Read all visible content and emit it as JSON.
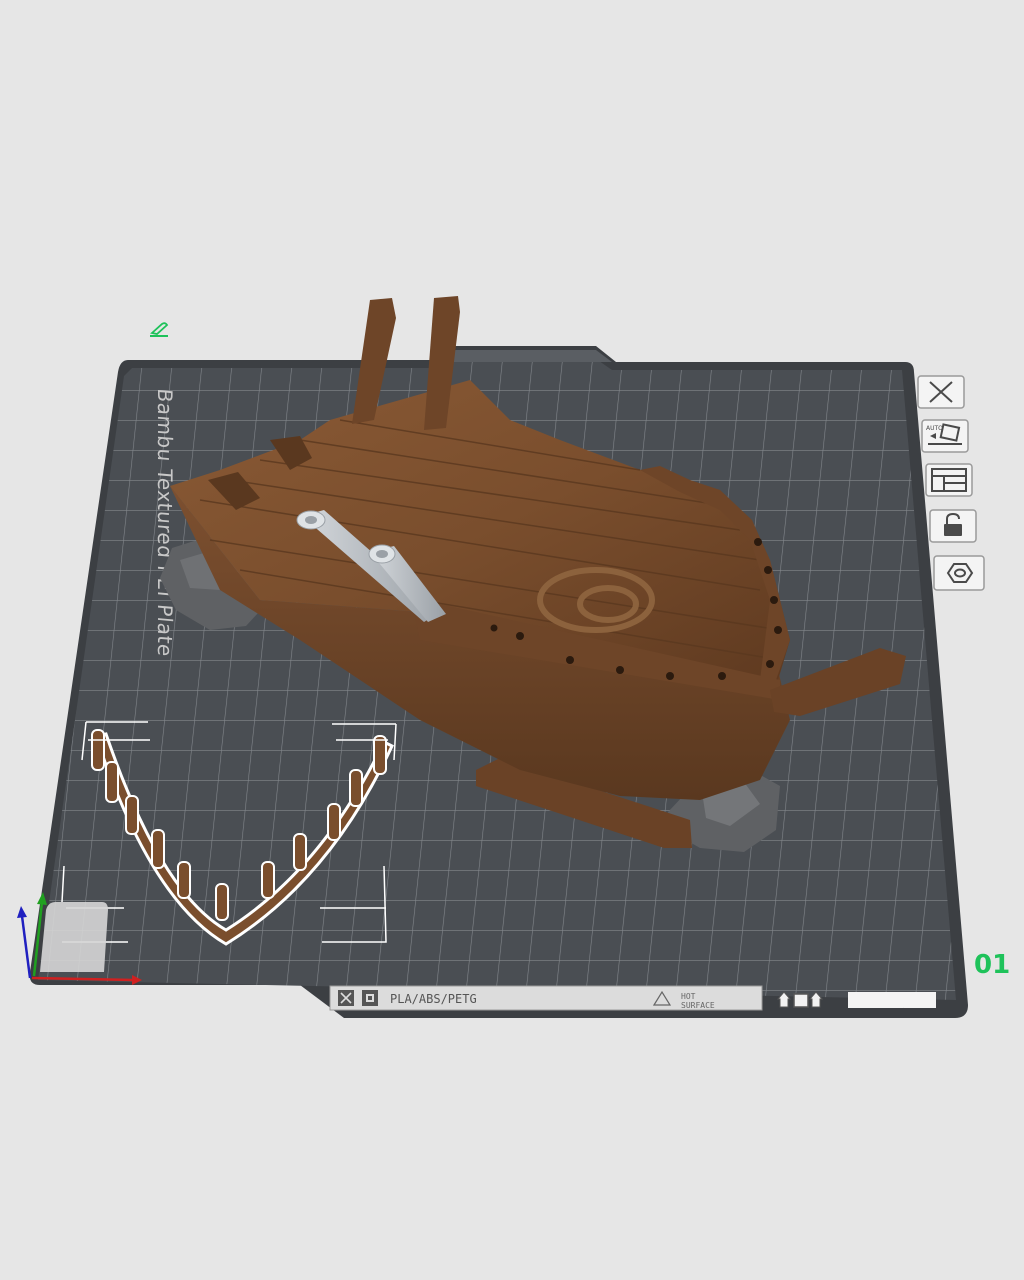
{
  "plate": {
    "label": "Bambu Textured PEI Plate",
    "number": "01",
    "color_plate": "#4a4e53",
    "color_grid": "#8a8e93",
    "color_border": "#3c3f43",
    "color_number": "#1ec25a"
  },
  "status_strip": {
    "filament_types": "PLA/ABS/PETG",
    "hot_surface_line1": "HOT",
    "hot_surface_line2": "SURFACE"
  },
  "toolbar": {
    "buttons": [
      {
        "name": "close-plate-button",
        "icon": "close-icon"
      },
      {
        "name": "auto-orient-button",
        "icon": "auto-orient-icon",
        "text": "AUTO"
      },
      {
        "name": "arrange-button",
        "icon": "arrange-icon"
      },
      {
        "name": "lock-plate-button",
        "icon": "lock-icon"
      },
      {
        "name": "plate-settings-button",
        "icon": "hexagon-settings-icon"
      }
    ]
  },
  "models": [
    {
      "name": "shipwreck-hull",
      "color": "#7a4e2d"
    },
    {
      "name": "cannon-pair",
      "color": "#b9bec3"
    },
    {
      "name": "rocks",
      "color": "#5f6164"
    },
    {
      "name": "rib-rail-part",
      "color": "#7a4e2d"
    }
  ],
  "axes": {
    "x_color": "#d02020",
    "y_color": "#20a020",
    "z_color": "#2020c0"
  },
  "edit_icon": {
    "icon": "edit-plate-name-icon",
    "color": "#1ec25a"
  }
}
